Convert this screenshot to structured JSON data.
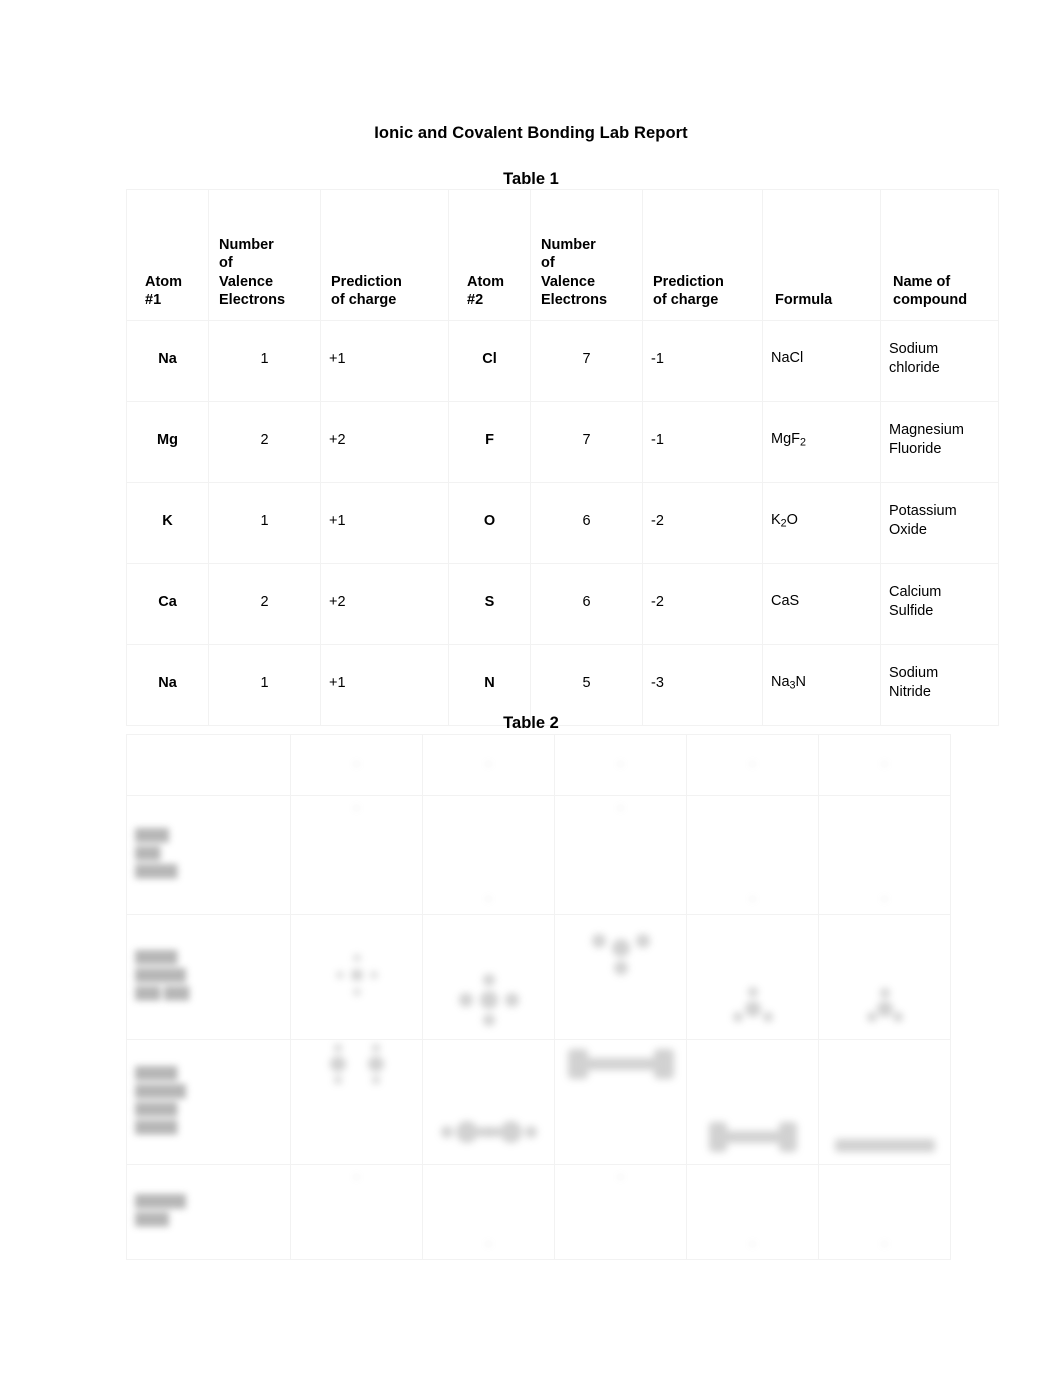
{
  "document": {
    "title": "Ionic and Covalent Bonding Lab Report"
  },
  "table1": {
    "caption": "Table 1",
    "headers": [
      "Atom\n#1",
      "Number\nof\nValence\nElectrons",
      "Prediction\nof charge",
      "Atom\n#2",
      "Number\nof\nValence\nElectrons",
      "Prediction\nof charge",
      "Formula",
      "Name of\ncompound"
    ],
    "rows": [
      {
        "atom1": "Na",
        "valence1": "1",
        "charge1": "+1",
        "atom2": "Cl",
        "valence2": "7",
        "charge2": "-1",
        "formula": "NaCl",
        "formula_base": "NaCl",
        "formula_sub": "",
        "formula_tail": "",
        "name": "Sodium\nchloride"
      },
      {
        "atom1": "Mg",
        "valence1": "2",
        "charge1": "+2",
        "atom2": "F",
        "valence2": "7",
        "charge2": "-1",
        "formula": "MgF2",
        "formula_base": "MgF",
        "formula_sub": "2",
        "formula_tail": "",
        "name": "Magnesium\nFluoride"
      },
      {
        "atom1": "K",
        "valence1": "1",
        "charge1": "+1",
        "atom2": "O",
        "valence2": "6",
        "charge2": "-2",
        "formula": "K2O",
        "formula_base": "K",
        "formula_sub": "2",
        "formula_tail": "O",
        "name": "Potassium\nOxide"
      },
      {
        "atom1": "Ca",
        "valence1": "2",
        "charge1": "+2",
        "atom2": "S",
        "valence2": "6",
        "charge2": "-2",
        "formula": "CaS",
        "formula_base": "CaS",
        "formula_sub": "",
        "formula_tail": "",
        "name": "Calcium\nSulfide"
      },
      {
        "atom1": "Na",
        "valence1": "1",
        "charge1": "+1",
        "atom2": "N",
        "valence2": "5",
        "charge2": "-3",
        "formula": "Na3N",
        "formula_base": "Na",
        "formula_sub": "3",
        "formula_tail": "N",
        "name": "Sodium\nNitride"
      }
    ]
  },
  "table2": {
    "caption": "Table 2",
    "legibility": "blurred",
    "note": "Contents of Table 2 are out of focus and illegible in the source image.",
    "columns": 6,
    "row_count": 5,
    "header_cells": [
      "",
      "▫",
      "▫",
      "▫",
      "▫",
      "▫"
    ],
    "row_labels": [
      "",
      "████\n███\n█████",
      "█████\n██████\n███ ███",
      "█████\n██████\n█████\n█████",
      "██████\n████"
    ],
    "cell_marks": [
      "▫",
      "▫",
      "▫",
      "▫",
      "▫"
    ]
  }
}
